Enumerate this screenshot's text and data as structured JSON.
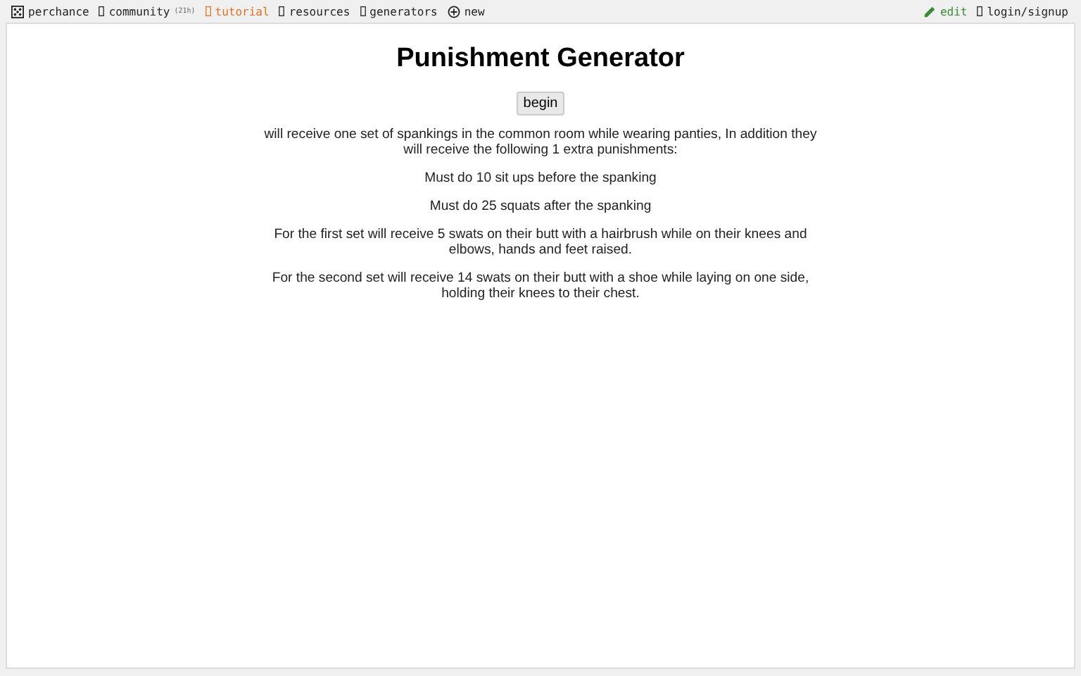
{
  "nav": {
    "left": [
      {
        "label": "perchance",
        "kind": "dice",
        "color": "#222222"
      },
      {
        "label": "community",
        "kind": "glyph",
        "color": "#222222",
        "badge": "(21h)"
      },
      {
        "label": "tutorial",
        "kind": "glyph",
        "color": "#e07020"
      },
      {
        "label": "resources",
        "kind": "glyph",
        "color": "#222222"
      },
      {
        "label": "generators",
        "kind": "glyph",
        "color": "#222222"
      },
      {
        "label": "new",
        "kind": "plus",
        "color": "#222222"
      }
    ],
    "right": [
      {
        "label": "edit",
        "kind": "pencil",
        "color": "#3a8a3a"
      },
      {
        "label": "login/signup",
        "kind": "glyph",
        "color": "#222222"
      }
    ]
  },
  "title": "Punishment Generator",
  "button": "begin",
  "paragraphs": [
    "will receive one set of spankings in the common room while wearing panties, In addition they will receive the following 1 extra punishments:",
    "Must do 10 sit ups before the spanking",
    "Must do 25 squats after the spanking",
    "For the first set will receive 5 swats on their butt with a hairbrush while on their knees and elbows, hands and feet raised.",
    "For the second set will receive 14 swats on their butt with a shoe while laying on one side, holding their knees to their chest."
  ]
}
